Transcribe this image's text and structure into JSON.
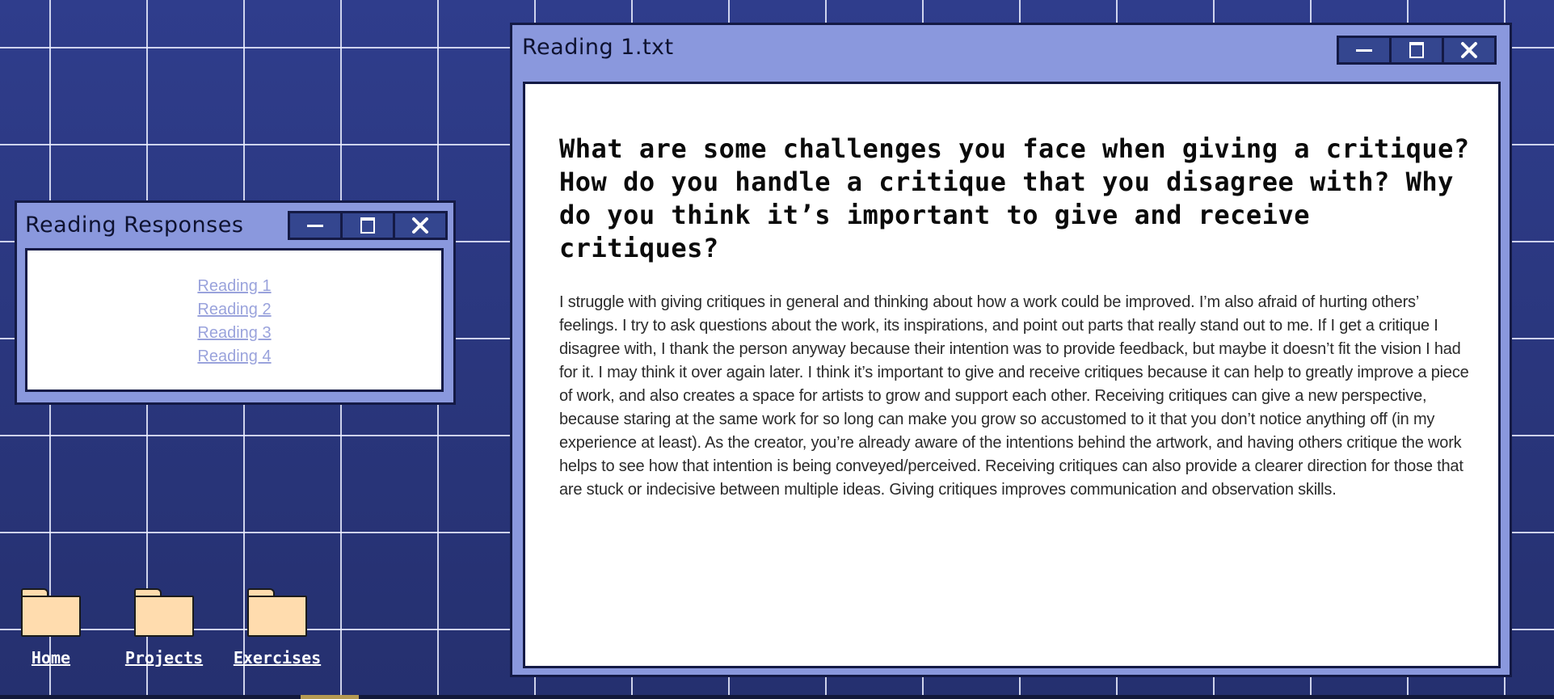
{
  "responses_window": {
    "title": "Reading Responses",
    "controls": {
      "minimize": "minimize-icon",
      "maximize": "maximize-icon",
      "close": "close-icon"
    },
    "links": [
      "Reading 1",
      "Reading 2",
      "Reading 3",
      "Reading 4"
    ]
  },
  "reading_window": {
    "title": "Reading 1.txt",
    "controls": {
      "minimize": "minimize-icon",
      "maximize": "maximize-icon",
      "close": "close-icon"
    },
    "question": "What are some challenges you face when giving a critique? How do you handle a critique that you disagree with? Why do you think it’s important to give and receive critiques?",
    "answer": "I struggle with giving critiques in general and thinking about how a work could be improved. I’m also afraid of hurting others’ feelings. I try to ask questions about the work, its inspirations, and point out parts that really stand out to me. If I get a critique I disagree with, I thank the person anyway because their intention was to provide feedback, but maybe it doesn’t fit the vision I had for it. I may think it over again later. I think it’s important to give and receive critiques because it can help to greatly improve a piece of work, and also creates a space for artists to grow and support each other. Receiving critiques can give a new perspective, because staring at the same work for so long can make you grow so accustomed to it that you don’t notice anything off (in my experience at least). As the creator, you’re already aware of the intentions behind the artwork, and having others critique the work helps to see how that intention is being conveyed/perceived. Receiving critiques can also provide a clearer direction for those that are stuck or indecisive between multiple ideas. Giving critiques improves communication and observation skills."
  },
  "desktop_icons": [
    {
      "label": "Home",
      "icon": "folder-icon"
    },
    {
      "label": "Projects",
      "icon": "folder-icon"
    },
    {
      "label": "Exercises",
      "icon": "folder-icon"
    }
  ],
  "colors": {
    "desktop_bg": "#2c3880",
    "window_frame": "#8a98dd",
    "window_border": "#141a45",
    "button_bg": "#34468f",
    "link": "#9aa3dc",
    "folder": "#ffdcae"
  }
}
